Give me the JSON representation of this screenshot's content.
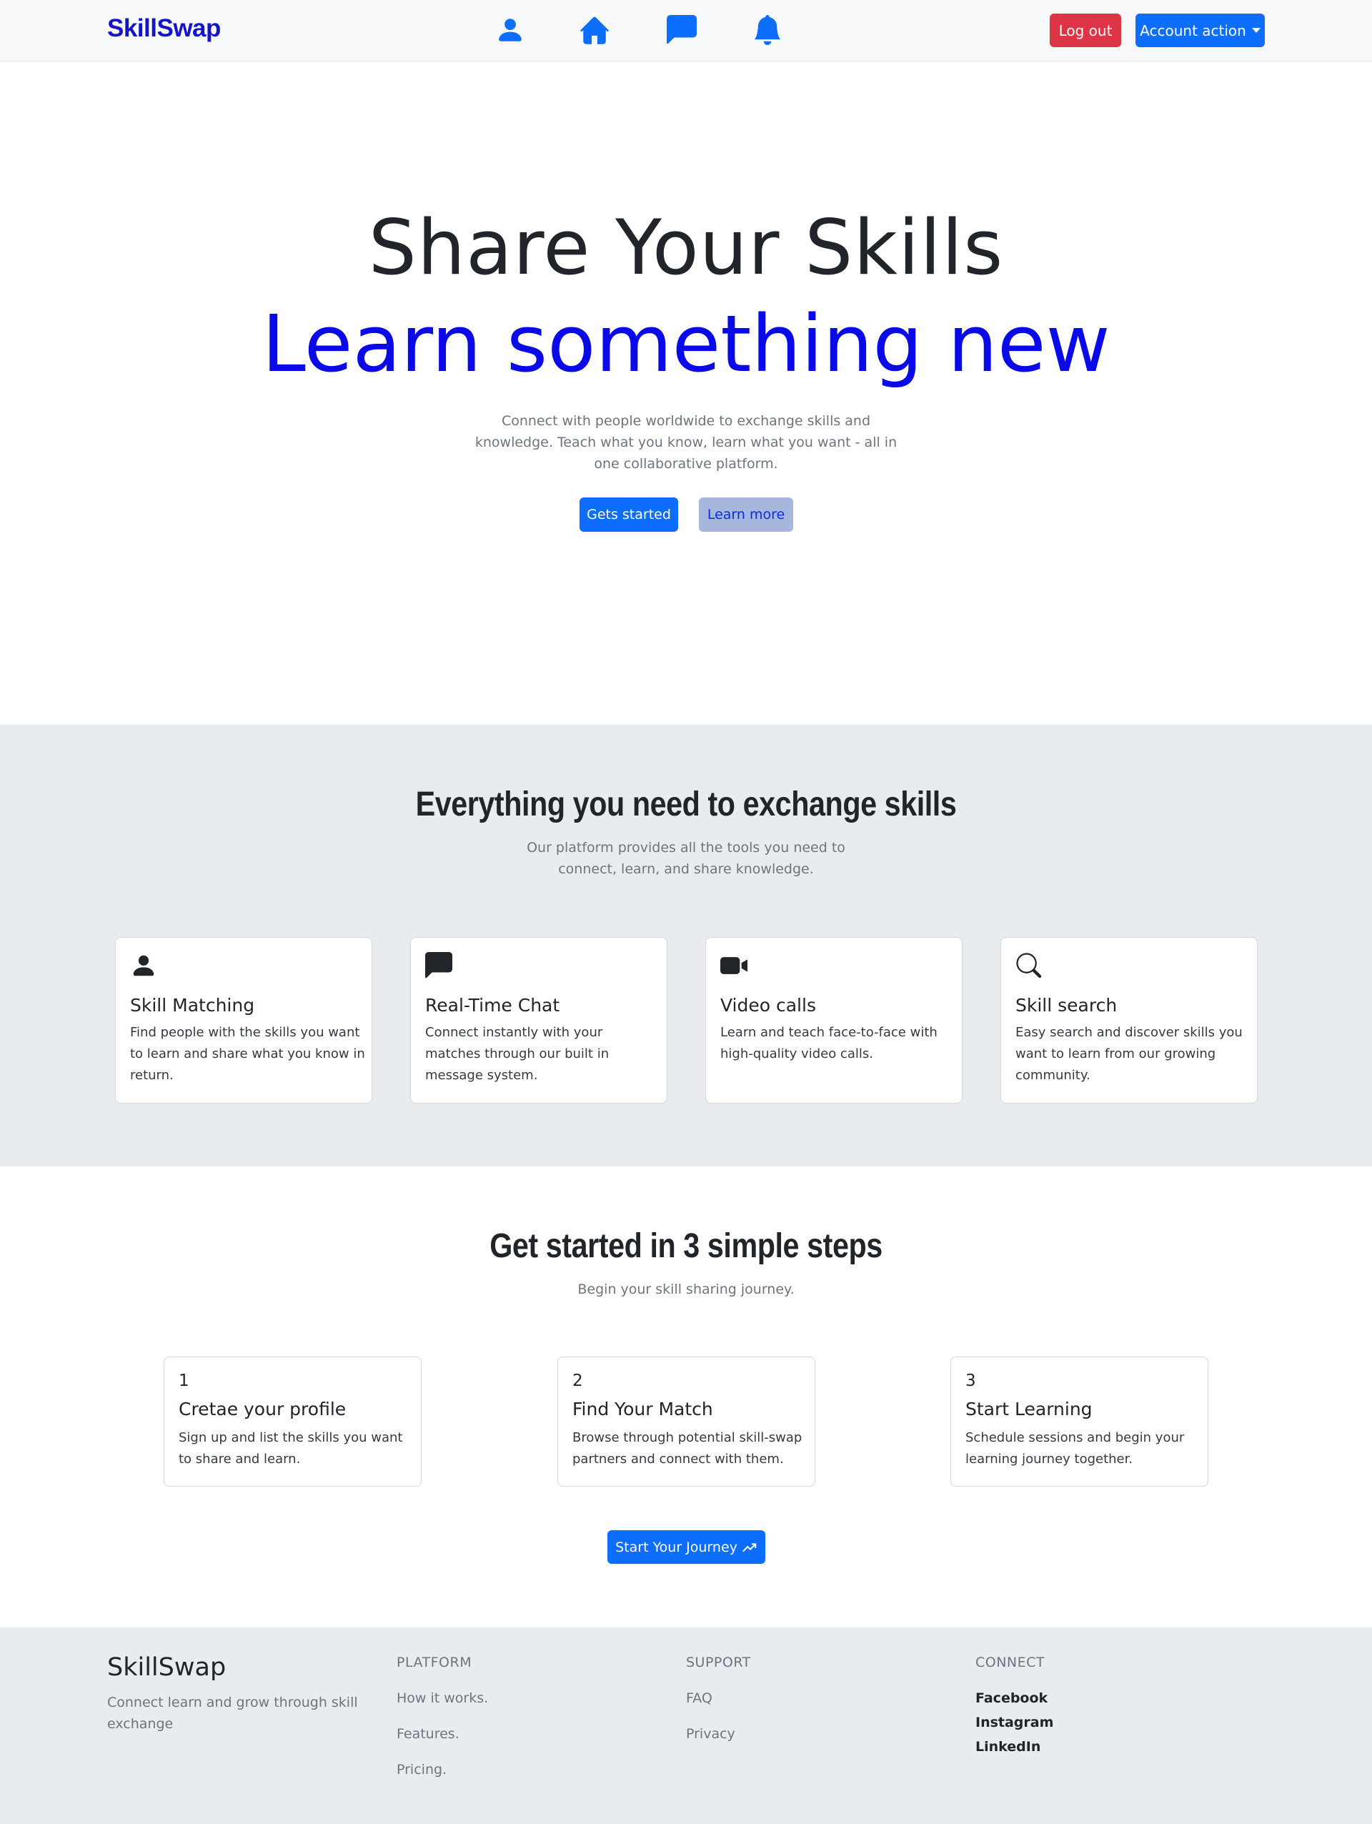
{
  "brand": "SkillSwap",
  "nav": {
    "icons": [
      "person-icon",
      "home-icon",
      "chat-icon",
      "bell-icon"
    ],
    "logout_label": "Log out",
    "account_label": "Account action"
  },
  "hero": {
    "title_line1": "Share Your Skills",
    "title_line2": "Learn something new",
    "description": "Connect with people worldwide to exchange skills and knowledge. Teach what you know, learn what you want - all in one collaborative platform.",
    "primary_button": "Gets started",
    "secondary_button": "Learn more"
  },
  "features": {
    "title": "Everything you need to exchange skills",
    "subtitle": "Our platform provides all the tools you need to connect, learn, and share knowledge.",
    "cards": [
      {
        "icon": "person-icon",
        "title": "Skill Matching",
        "text": "Find people with the skills you want to learn and share what you know in return."
      },
      {
        "icon": "chat-icon",
        "title": "Real-Time Chat",
        "text": "Connect instantly with your matches through our built in message system."
      },
      {
        "icon": "video-camera-icon",
        "title": "Video calls",
        "text": "Learn and teach face-to-face with high-quality video calls."
      },
      {
        "icon": "search-icon",
        "title": "Skill search",
        "text": "Easy search and discover skills you want to learn from our growing community."
      }
    ]
  },
  "steps": {
    "title": "Get started in 3 simple steps",
    "subtitle": "Begin your skill sharing journey.",
    "cards": [
      {
        "number": "1",
        "title": "Cretae your profile",
        "text": "Sign up and list the skills you want to share and learn."
      },
      {
        "number": "2",
        "title": "Find Your Match",
        "text": "Browse through potential skill-swap partners and connect with them."
      },
      {
        "number": "3",
        "title": "Start Learning",
        "text": "Schedule sessions and begin your learning journey together."
      }
    ],
    "cta_button": "Start Your Journey",
    "cta_icon": "trending-up-icon"
  },
  "footer": {
    "brand": "SkillSwap",
    "tagline": "Connect learn and grow through skill exchange",
    "platform": {
      "heading": "PLATFORM",
      "links": [
        "How it works.",
        "Features.",
        "Pricing."
      ]
    },
    "support": {
      "heading": "SUPPORT",
      "links": [
        "FAQ",
        "Privacy"
      ]
    },
    "connect": {
      "heading": "CONNECT",
      "links": [
        "Facebook",
        "Instagram",
        "LinkedIn"
      ]
    }
  },
  "colors": {
    "brand": "#1515c8",
    "primary": "#0d6efd",
    "danger": "#dc3545",
    "accent_title": "#0a0ae8",
    "section_bg": "#e9ecef"
  }
}
